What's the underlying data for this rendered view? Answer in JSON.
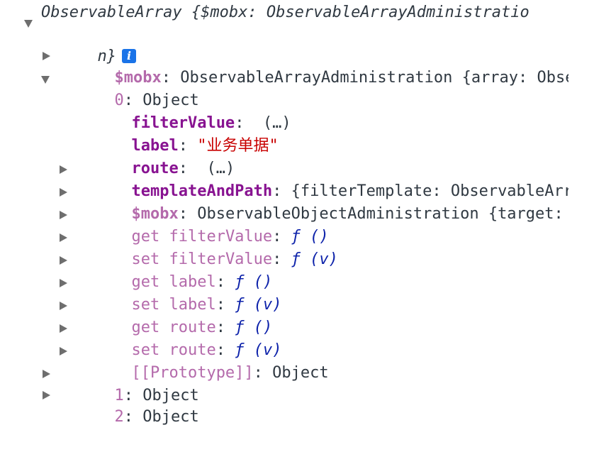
{
  "root": {
    "summary_line1": "ObservableArray {$mobx: ObservableArrayAdministratio",
    "summary_line2": "n}",
    "info_icon": "i"
  },
  "rows": {
    "mobx_top": {
      "key": "$mobx",
      "sep": ": ",
      "value": "ObservableArrayAdministration {array: Observ"
    },
    "item0": {
      "key": "0",
      "sep": ": ",
      "value": "Object"
    },
    "filterValue": {
      "key": "filterValue",
      "sep": ": ",
      "value": " (…)"
    },
    "label": {
      "key": "label",
      "sep": ": ",
      "value": "\"业务单据\""
    },
    "route": {
      "key": "route",
      "sep": ": ",
      "value": " (…)"
    },
    "templateAndPath": {
      "key": "templateAndPath",
      "sep": ": ",
      "value": "{filterTemplate: ObservableArray"
    },
    "mobx_obj": {
      "key": "$mobx",
      "sep": ": ",
      "value": "ObservableObjectAdministration {target: {…"
    },
    "get_filterValue": {
      "kw": "get ",
      "key": "filterValue",
      "sep": ": ",
      "f": "ƒ",
      "args": " ()"
    },
    "set_filterValue": {
      "kw": "set ",
      "key": "filterValue",
      "sep": ": ",
      "f": "ƒ",
      "args": " (v)"
    },
    "get_label": {
      "kw": "get ",
      "key": "label",
      "sep": ": ",
      "f": "ƒ",
      "args": " ()"
    },
    "set_label": {
      "kw": "set ",
      "key": "label",
      "sep": ": ",
      "f": "ƒ",
      "args": " (v)"
    },
    "get_route": {
      "kw": "get ",
      "key": "route",
      "sep": ": ",
      "f": "ƒ",
      "args": " ()"
    },
    "set_route": {
      "kw": "set ",
      "key": "route",
      "sep": ": ",
      "f": "ƒ",
      "args": " (v)"
    },
    "prototype": {
      "key": "[[Prototype]]",
      "sep": ": ",
      "value": "Object"
    },
    "item1": {
      "key": "1",
      "sep": ": ",
      "value": "Object"
    },
    "item2": {
      "key": "2",
      "sep": ": ",
      "value": "Object"
    }
  },
  "colors": {
    "key": "#881391",
    "dim_key": "#b46aab",
    "string": "#c80000",
    "function": "#0d22aa",
    "badge": "#1a73e8"
  }
}
